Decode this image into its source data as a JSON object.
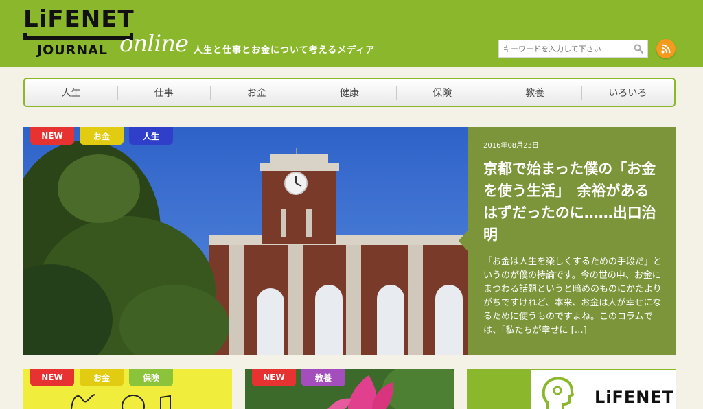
{
  "header": {
    "logo_top": "LiFENET",
    "logo_journal": "JOURNAL",
    "logo_online": "online",
    "tagline": "人生と仕事とお金について考えるメディア",
    "search_placeholder": "キーワードを入力して下さい"
  },
  "nav": {
    "items": [
      "人生",
      "仕事",
      "お金",
      "健康",
      "保険",
      "教養",
      "いろいろ"
    ]
  },
  "hero": {
    "tags": [
      "NEW",
      "お金",
      "人生"
    ],
    "date": "2016年08月23日",
    "title": "京都で始まった僕の「お金を使う生活」　余裕があるはずだったのに……出口治明",
    "excerpt": "「お金は人生を楽しくするための手段だ」というのが僕の持論です。今の世の中、お金にまつわる話題というと暗めのものにかたよりがちですけれど、本来、お金は人が幸せになるために使うものですよね。このコラムでは、「私たちが幸せに […]"
  },
  "cards": [
    {
      "tags": [
        "NEW",
        "お金",
        "保険"
      ]
    },
    {
      "tags": [
        "NEW",
        "教養"
      ]
    },
    {
      "logo": "LiFENET"
    }
  ],
  "colors": {
    "brand_green": "#8ab72c",
    "hero_panel": "#7c953a",
    "tag_new": "#e63332",
    "tag_money": "#e2cc12",
    "tag_life": "#2f3fc9",
    "tag_insurance": "#8bc43a",
    "tag_culture": "#a34ebc",
    "rss": "#f49a1e"
  }
}
